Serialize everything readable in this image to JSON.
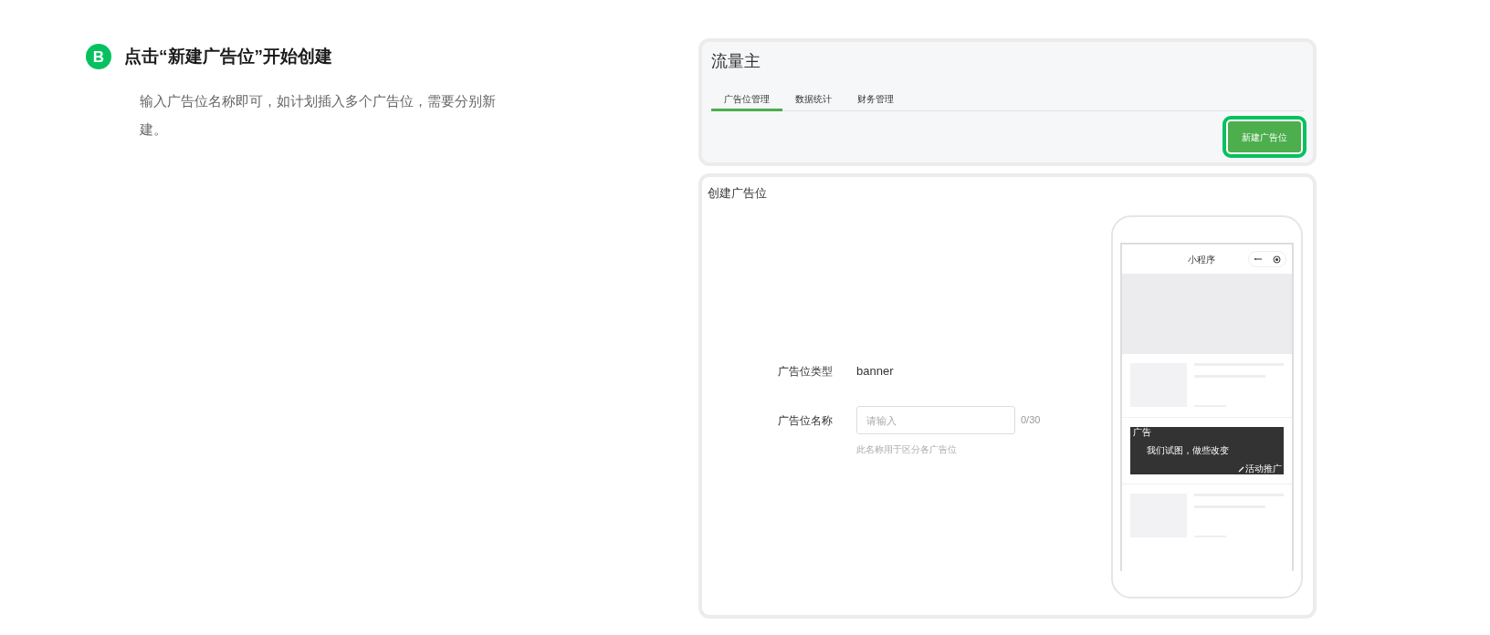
{
  "step": {
    "badge": "B",
    "title": "点击“新建广告位”开始创建",
    "description": "输入广告位名称即可，如计划插入多个广告位，需要分别新建。"
  },
  "app": {
    "title": "流量主",
    "tabs": [
      {
        "label": "广告位管理",
        "selected": true
      },
      {
        "label": "数据统计",
        "selected": false
      },
      {
        "label": "财务管理",
        "selected": false
      }
    ],
    "new_button": {
      "label": "新建广告位",
      "highlighted": true
    }
  },
  "create_panel": {
    "title": "创建广告位",
    "type_row": {
      "label": "广告位类型",
      "value": "banner"
    },
    "name_row": {
      "label": "广告位名称",
      "placeholder": "请输入",
      "counter": "0/30",
      "hint": "此名称用于区分各广告位"
    }
  },
  "phone_preview": {
    "nav_title": "小程序",
    "ad": {
      "tag": "广告",
      "slogan": "我们试图，做些改变",
      "link": "活动推广"
    }
  }
}
